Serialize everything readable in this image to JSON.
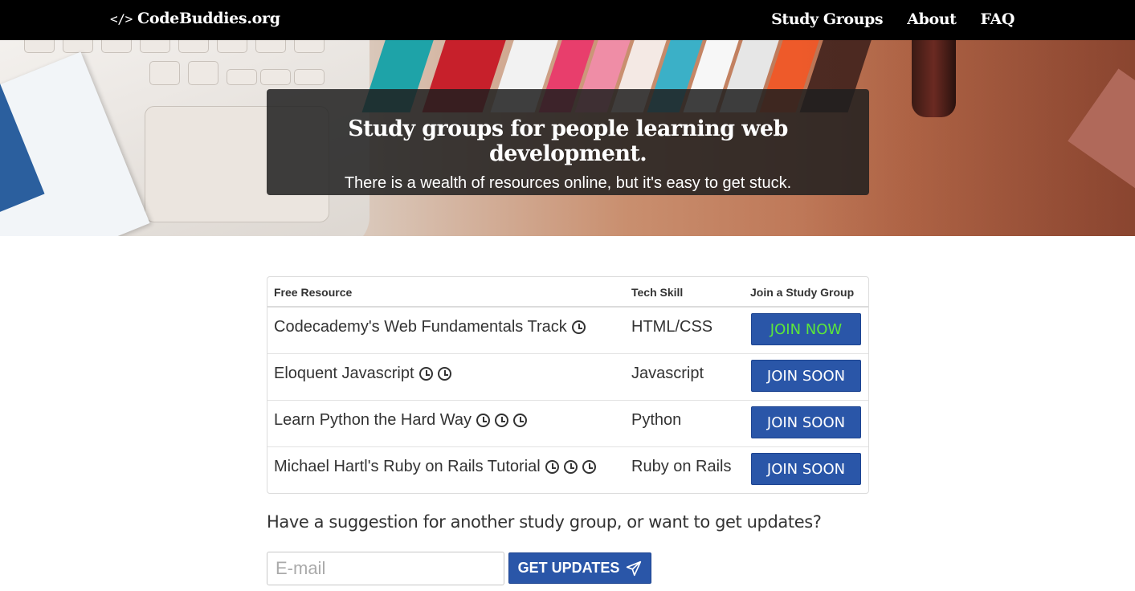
{
  "nav": {
    "brand_icon": "</>",
    "brand": "CodeBuddies.org",
    "links": [
      "Study Groups",
      "About",
      "FAQ"
    ]
  },
  "hero": {
    "title": "Study groups for people learning web development.",
    "subtitle": "There is a wealth of resources online, but it's easy to get stuck."
  },
  "table": {
    "headers": [
      "Free Resource",
      "Tech Skill",
      "Join a Study Group"
    ],
    "rows": [
      {
        "resource": "Codecademy's Web Fundamentals Track",
        "clocks": 1,
        "skill": "HTML/CSS",
        "button": "JOIN NOW",
        "button_color": "#5ce63b"
      },
      {
        "resource": "Eloquent Javascript",
        "clocks": 2,
        "skill": "Javascript",
        "button": "JOIN SOON",
        "button_color": "#ffffff"
      },
      {
        "resource": "Learn Python the Hard Way",
        "clocks": 3,
        "skill": "Python",
        "button": "JOIN SOON",
        "button_color": "#ffffff"
      },
      {
        "resource": "Michael Hartl's Ruby on Rails Tutorial",
        "clocks": 3,
        "skill": "Ruby on Rails",
        "button": "JOIN SOON",
        "button_color": "#ffffff"
      }
    ]
  },
  "signup": {
    "prompt": "Have a suggestion for another study group, or want to get updates?",
    "email_placeholder": "E-mail",
    "button_label": "GET UPDATES",
    "button_icon": "paper-plane-icon"
  },
  "colors": {
    "navbar": "#000000",
    "button_blue": "#2a56a8",
    "join_now_text": "#5ce63b"
  }
}
